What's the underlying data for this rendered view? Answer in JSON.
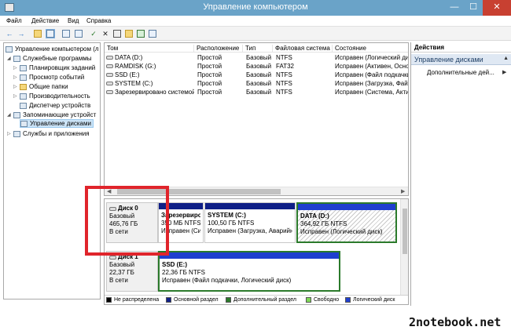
{
  "window": {
    "title": "Управление компьютером",
    "min_label": "—",
    "max_label": "☐",
    "close_label": "✕"
  },
  "menu": [
    "Файл",
    "Действие",
    "Вид",
    "Справка"
  ],
  "toolbar": {
    "back": "←",
    "forward": "→",
    "check": "✓",
    "delete": "✕"
  },
  "tree": {
    "root": "Управление компьютером (л",
    "items": [
      {
        "label": "Служебные программы"
      },
      {
        "label": "Планировщик заданий"
      },
      {
        "label": "Просмотр событий"
      },
      {
        "label": "Общие папки"
      },
      {
        "label": "Производительность"
      },
      {
        "label": "Диспетчер устройств"
      },
      {
        "label": "Запоминающие устройст"
      },
      {
        "label": "Управление дисками"
      },
      {
        "label": "Службы и приложения"
      }
    ]
  },
  "list": {
    "columns": [
      "Том",
      "Расположение",
      "Тип",
      "Файловая система",
      "Состояние"
    ],
    "rows": [
      {
        "vol": "DATA (D:)",
        "loc": "Простой",
        "type": "Базовый",
        "fs": "NTFS",
        "state": "Исправен (Логический дий"
      },
      {
        "vol": "RAMDISK (G:)",
        "loc": "Простой",
        "type": "Базовый",
        "fs": "FAT32",
        "state": "Исправен (Активен, Основ"
      },
      {
        "vol": "SSD (E:)",
        "loc": "Простой",
        "type": "Базовый",
        "fs": "NTFS",
        "state": "Исправен (Файл подкачки"
      },
      {
        "vol": "SYSTEM (C:)",
        "loc": "Простой",
        "type": "Базовый",
        "fs": "NTFS",
        "state": "Исправен (Загрузка, Файл"
      },
      {
        "vol": "Зарезервировано системой",
        "loc": "Простой",
        "type": "Базовый",
        "fs": "NTFS",
        "state": "Исправен (Система, Акти"
      }
    ],
    "scroll_left": "◀",
    "scroll_right": "▶"
  },
  "disks": [
    {
      "name": "Диск 0",
      "kind": "Базовый",
      "size": "465,76 ГБ",
      "status": "В сети",
      "partitions": [
        {
          "name": "Зарезервиро",
          "size": "350 МБ NTFS",
          "state": "Исправен (Си"
        },
        {
          "name": "SYSTEM  (C:)",
          "size": "100,50 ГБ NTFS",
          "state": "Исправен (Загрузка, Аварийн"
        },
        {
          "name": "DATA  (D:)",
          "size": "364,92 ГБ NTFS",
          "state": "Исправен (Логический диск)"
        }
      ]
    },
    {
      "name": "Диск 1",
      "kind": "Базовый",
      "size": "22,37 ГБ",
      "status": "В сети",
      "partitions": [
        {
          "name": "SSD  (E:)",
          "size": "22,36 ГБ NTFS",
          "state": "Исправен (Файл подкачки, Логический диск)"
        }
      ]
    }
  ],
  "legend": [
    {
      "label": "Не распределена",
      "color": "#000000"
    },
    {
      "label": "Основной раздел",
      "color": "#0f1f87"
    },
    {
      "label": "Дополнительный раздел",
      "color": "#2b7a2b"
    },
    {
      "label": "Свободно",
      "color": "#7ed957"
    },
    {
      "label": "Логический диск",
      "color": "#1f3fcf"
    }
  ],
  "actions": {
    "header": "Действия",
    "section": "Управление дисками",
    "section_caret": "▲",
    "item": "Дополнительные дей...",
    "item_caret": "▶"
  },
  "watermark": "2notebook.net",
  "colors": {
    "titlebar": "#6aa3c8",
    "close": "#c84031",
    "primary_bar": "#0f1f87",
    "selected_border": "#2b7a2b",
    "highlight": "#e0242b"
  }
}
